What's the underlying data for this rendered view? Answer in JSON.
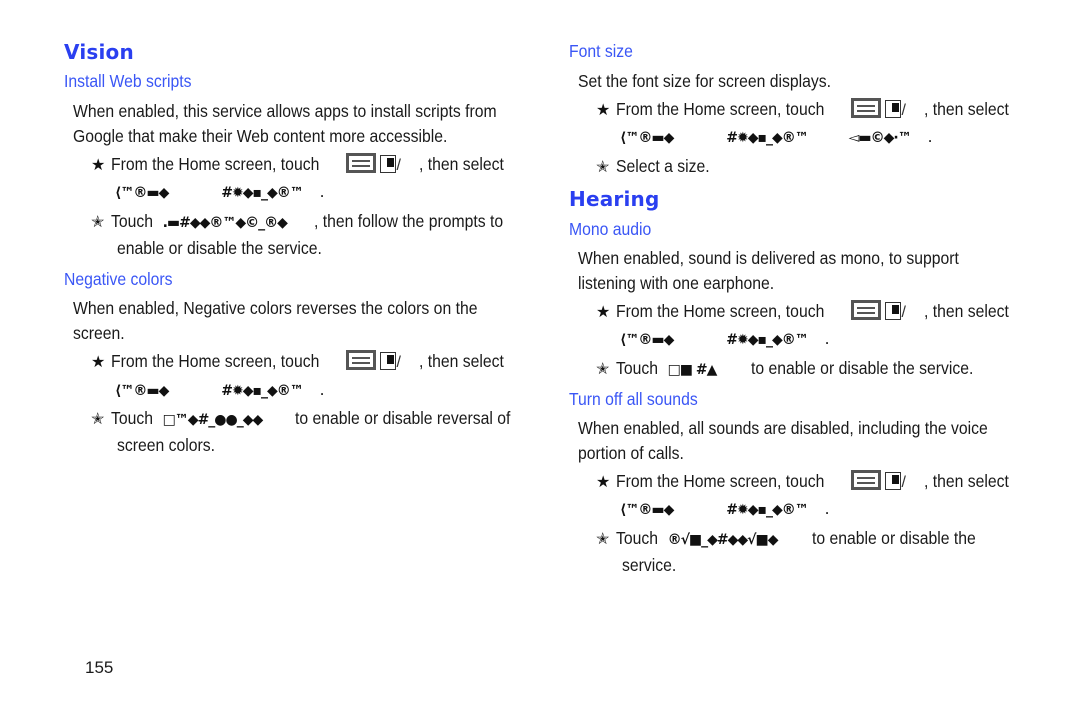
{
  "page_number": "155",
  "left": {
    "vision": {
      "heading": "Vision",
      "install_web_scripts": {
        "title": "Install Web scripts",
        "desc_line1": "When enabled, this service allows apps to install scripts from",
        "desc_line2": "Google that make their Web content more accessible.",
        "step1_prefix": "From the Home screen, touch",
        "step1_suffix": ", then select",
        "step1_garble_a": "⟨™®▬◆",
        "step1_garble_b": "#✹◆▪_◆®™",
        "step1_end": ".",
        "step2_prefix": "Touch",
        "step2_garble": ".▬#◆◆®™◆©_®◆",
        "step2_suffix": ", then follow the prompts to",
        "step2_line2": "enable or disable the service."
      },
      "negative_colors": {
        "title": "Negative colors",
        "desc_line1": "When enabled, Negative colors reverses the colors on the",
        "desc_line2": "screen.",
        "step1_prefix": "From the Home screen, touch",
        "step1_suffix": ", then select",
        "step1_garble_a": "⟨™®▬◆",
        "step1_garble_b": "#✹◆▪_◆®™",
        "step1_end": ".",
        "step2_prefix": "Touch",
        "step2_garble": "□™◆#_●●_◆◆",
        "step2_suffix": "to enable or disable reversal of",
        "step2_line2": "screen colors."
      }
    }
  },
  "right": {
    "font_size": {
      "title": "Font size",
      "desc": "Set the font size for screen displays.",
      "step1_prefix": "From the Home screen, touch",
      "step1_suffix": ", then select",
      "step1_garble_a": "⟨™®▬◆",
      "step1_garble_b": "#✹◆▪_◆®™",
      "step1_garble_c": "◅▬©◆·™",
      "step1_end": ".",
      "step2": "Select a size."
    },
    "hearing": {
      "heading": "Hearing",
      "mono_audio": {
        "title": "Mono audio",
        "desc_line1": "When enabled, sound is delivered as mono, to support",
        "desc_line2": "listening with one earphone.",
        "step1_prefix": "From the Home screen, touch",
        "step1_suffix": ", then select",
        "step1_garble_a": "⟨™®▬◆",
        "step1_garble_b": "#✹◆▪_◆®™",
        "step1_end": ".",
        "step2_prefix": "Touch",
        "step2_garble": "□■ #▲",
        "step2_suffix": "to enable or disable the service."
      },
      "turn_off_all_sounds": {
        "title": "Turn off all sounds",
        "desc_line1": "When enabled, all sounds are disabled, including the voice",
        "desc_line2": "portion of calls.",
        "step1_prefix": "From the Home screen, touch",
        "step1_suffix": ", then select",
        "step1_garble_a": "⟨™®▬◆",
        "step1_garble_b": "#✹◆▪_◆®™",
        "step1_end": ".",
        "step2_prefix": "Touch",
        "step2_garble": "®√■_◆#◆◆√■◆",
        "step2_suffix": "to enable or disable the",
        "step2_line2": "service."
      }
    }
  }
}
